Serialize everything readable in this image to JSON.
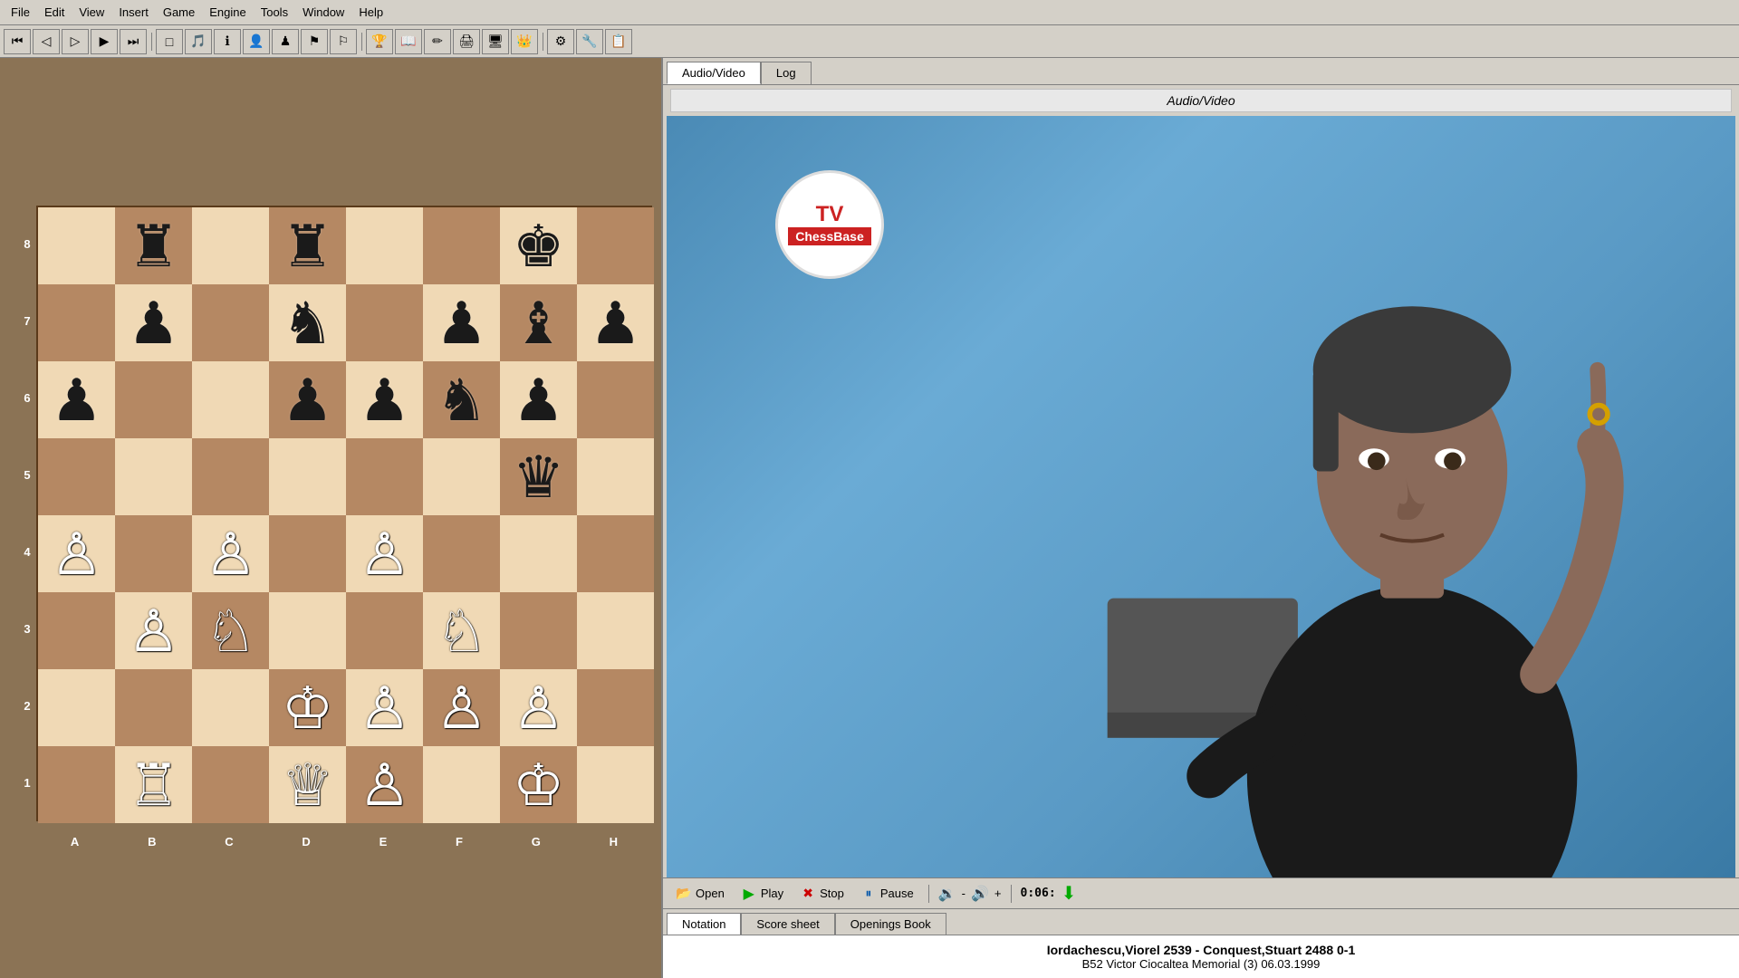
{
  "menubar": {
    "items": [
      "File",
      "Edit",
      "View",
      "Insert",
      "Game",
      "Engine",
      "Tools",
      "Window",
      "Help"
    ]
  },
  "toolbar": {
    "nav_buttons": [
      "⏮",
      "◁",
      "▷",
      "▶",
      "⏭"
    ],
    "icons": [
      "□",
      "🎵",
      "ℹ",
      "👤",
      "♟",
      "⚑",
      "🏳",
      "🏆",
      "📖",
      "✏",
      "🖨",
      "🖥",
      "👑",
      "⚙",
      "🔧",
      "📋"
    ]
  },
  "board": {
    "ranks": [
      "8",
      "7",
      "6",
      "5",
      "4",
      "3",
      "2",
      "1"
    ],
    "files": [
      "A",
      "B",
      "C",
      "D",
      "E",
      "F",
      "G",
      "H"
    ],
    "pieces": {
      "a8": "",
      "b8": "♜",
      "c8": "",
      "d8": "♜",
      "e8": "",
      "f8": "",
      "g8": "♚",
      "h8": "",
      "a7": "",
      "b7": "♟",
      "c7": "",
      "d7": "♞",
      "e7": "",
      "f7": "♟",
      "g7": "♝",
      "h7": "♟",
      "a6": "♟",
      "b6": "",
      "c6": "",
      "d6": "♟",
      "e6": "♟",
      "f6": "♞",
      "g6": "♟",
      "h6": "",
      "a5": "",
      "b5": "",
      "c5": "",
      "d5": "",
      "e5": "",
      "f5": "",
      "g5": "♛",
      "h5": "",
      "a4": "♙",
      "b4": "",
      "c4": "♙",
      "d4": "",
      "e4": "♙",
      "f4": "",
      "g4": "",
      "h4": "",
      "a3": "",
      "b3": "♙",
      "c3": "♘",
      "d3": "",
      "e3": "",
      "f3": "♘",
      "g3": "",
      "h3": "",
      "a2": "",
      "b2": "",
      "c2": "",
      "d2": "♔",
      "e2": "♙",
      "f2": "♙",
      "g2": "♙",
      "h2": "",
      "a1": "",
      "b1": "♖",
      "c1": "",
      "d1": "♕",
      "e1": "♙",
      "f1": "",
      "g1": "♔",
      "h1": ""
    }
  },
  "av_panel": {
    "tabs": [
      "Audio/Video",
      "Log"
    ],
    "active_tab": "Audio/Video",
    "title": "Audio/Video"
  },
  "video_controls": {
    "open_label": "Open",
    "play_label": "Play",
    "stop_label": "Stop",
    "pause_label": "Pause",
    "vol_minus": "-",
    "vol_plus": "+",
    "time": "0:06:"
  },
  "notation_panel": {
    "tabs": [
      "Notation",
      "Score sheet",
      "Openings Book"
    ],
    "active_tab": "Notation",
    "game_title": "Iordachescu,Viorel 2539  -  Conquest,Stuart  2488  0-1",
    "game_subtitle": "B52  Victor Ciocaltea Memorial (3) 06.03.1999"
  }
}
